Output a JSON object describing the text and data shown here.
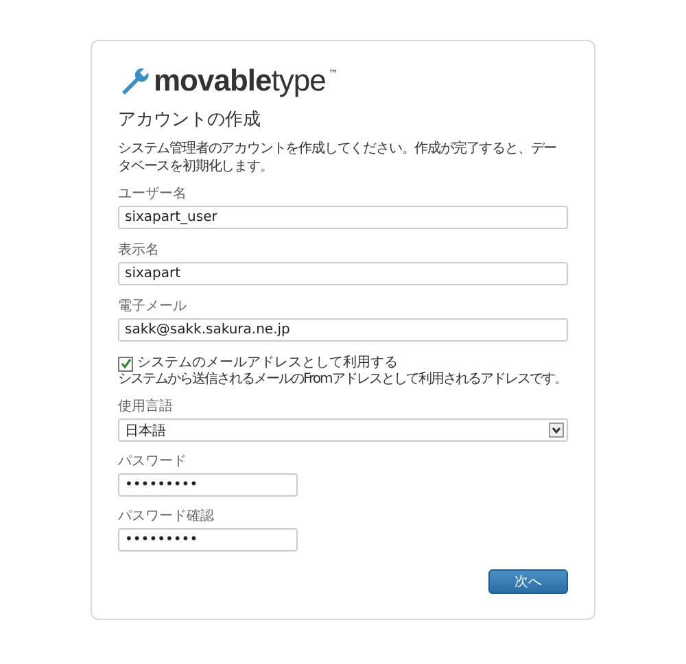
{
  "logo": {
    "text": "**movable**type",
    "trademark": "™"
  },
  "title": "アカウントの作成",
  "description": "システム管理者のアカウントを作成してください。作成が完了すると、データベースを初期化します。",
  "fields": [
    {
      "kind": "text",
      "label": "ユーザー名",
      "value": "sixapart_user"
    },
    {
      "kind": "text",
      "label": "表示名",
      "value": "sixapart"
    },
    {
      "kind": "text",
      "label": "電子メール",
      "value": "sakk@sakk.sakura.ne.jp"
    },
    {
      "kind": "checkbox",
      "label": "システムのメールアドレスとして利用する",
      "checked": true,
      "hint": "システムから送信されるメールのFromアドレスとして利用されるアドレスです。"
    },
    {
      "kind": "select",
      "label": "使用言語",
      "value": "日本語"
    },
    {
      "kind": "password",
      "label": "パスワード",
      "value": "•••••••••"
    },
    {
      "kind": "password",
      "label": "パスワード確認",
      "value": "•••••••••"
    }
  ],
  "next_button": "次へ"
}
